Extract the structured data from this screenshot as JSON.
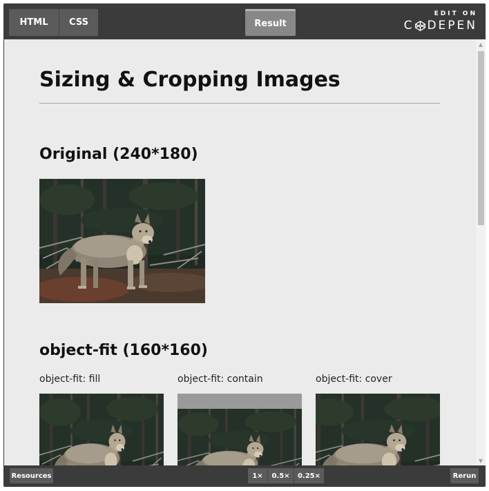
{
  "toolbar": {
    "tabs": [
      {
        "label": "HTML"
      },
      {
        "label": "CSS"
      }
    ],
    "result_label": "Result",
    "edit_on": "EDIT ON",
    "codepen_pre": "C",
    "codepen_post": "DEPEN"
  },
  "page": {
    "title": "Sizing & Cropping Images",
    "section_original": "Original (240*180)",
    "section_object_fit": "object-fit (160*160)",
    "labels": [
      "object-fit: fill",
      "object-fit: contain",
      "object-fit: cover"
    ]
  },
  "icons": {
    "codepen_logo": "codepen-cube-icon",
    "scroll_up": "scroll-up-arrow-icon",
    "scroll_down": "scroll-down-arrow-icon"
  },
  "bottom": {
    "resources_label": "Resources",
    "zoom": [
      "1×",
      "0.5×",
      "0.25×"
    ],
    "rerun_label": "Rerun"
  },
  "colors": {
    "bar": "#3b3b3b",
    "button": "#5b5b5b",
    "result_tab": "#888888",
    "page_bg": "#ebebeb",
    "contain_letterbox": "#9a9a9a"
  }
}
